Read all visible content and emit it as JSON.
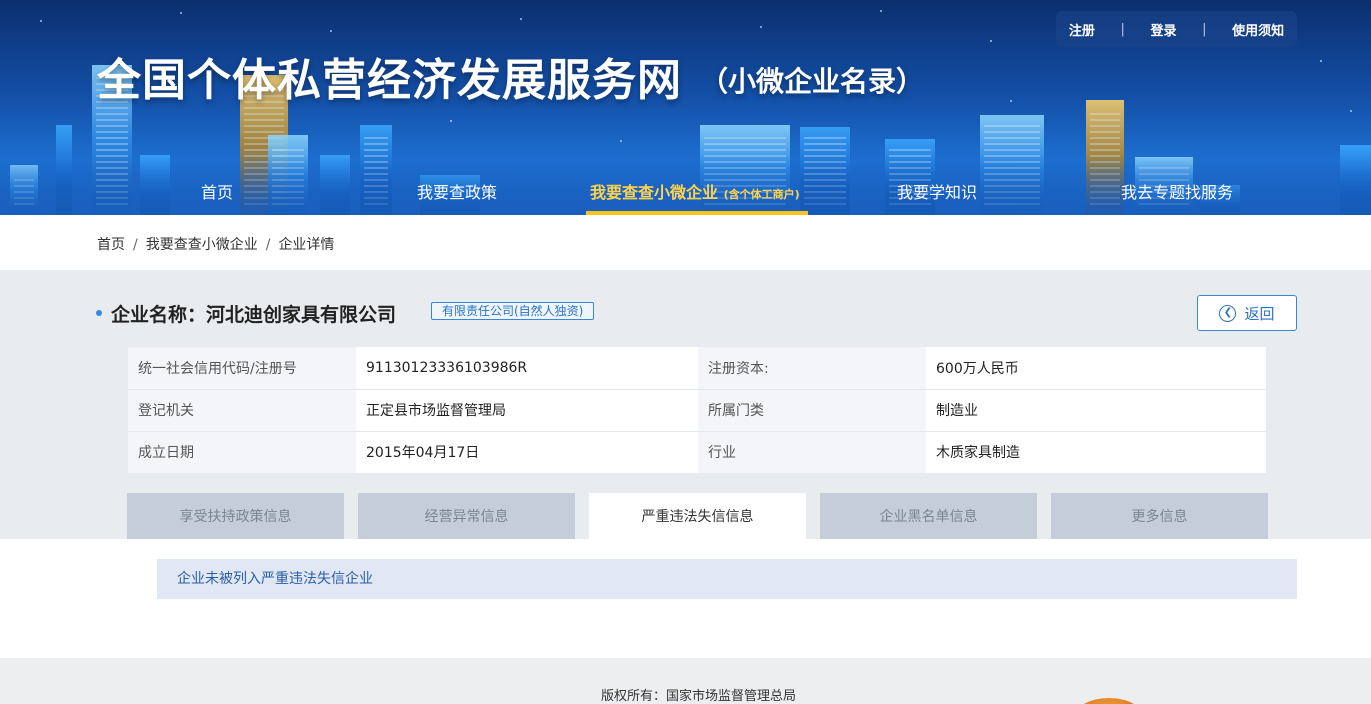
{
  "header": {
    "title": "全国个体私营经济发展服务网",
    "subtitle": "（小微企业名录）",
    "top_links": [
      "注册",
      "登录",
      "使用须知"
    ],
    "nav": [
      {
        "label": "首页"
      },
      {
        "label": "我要查政策"
      },
      {
        "label": "我要查查小微企业",
        "suffix": "(含个体工商户)",
        "active": true
      },
      {
        "label": "我要学知识"
      },
      {
        "label": "我去专题找服务"
      }
    ],
    "accent_color": "#ffc21a"
  },
  "breadcrumb": [
    "首页",
    "我要查查小微企业",
    "企业详情"
  ],
  "company": {
    "title": "企业名称：河北迪创家具有限公司",
    "type_tag": "有限责任公司(自然人独资)",
    "back_label": "返回",
    "back_icon": "back-arrow-icon",
    "fields": [
      {
        "k1": "统一社会信用代码/注册号",
        "v1": "91130123336103986R",
        "k2": "注册资本:",
        "v2": "600万人民币"
      },
      {
        "k1": "登记机关",
        "v1": "正定县市场监督管理局",
        "k2": "所属门类",
        "v2": "制造业"
      },
      {
        "k1": "成立日期",
        "v1": "2015年04月17日",
        "k2": "行业",
        "v2": "木质家具制造"
      }
    ]
  },
  "tabs": [
    {
      "label": "享受扶持政策信息"
    },
    {
      "label": "经营异常信息"
    },
    {
      "label": "严重违法失信信息",
      "active": true
    },
    {
      "label": "企业黑名单信息"
    },
    {
      "label": "更多信息"
    }
  ],
  "notice": "企业未被列入严重违法失信企业",
  "footer": {
    "copyright": "版权所有：国家市场监督管理总局"
  }
}
